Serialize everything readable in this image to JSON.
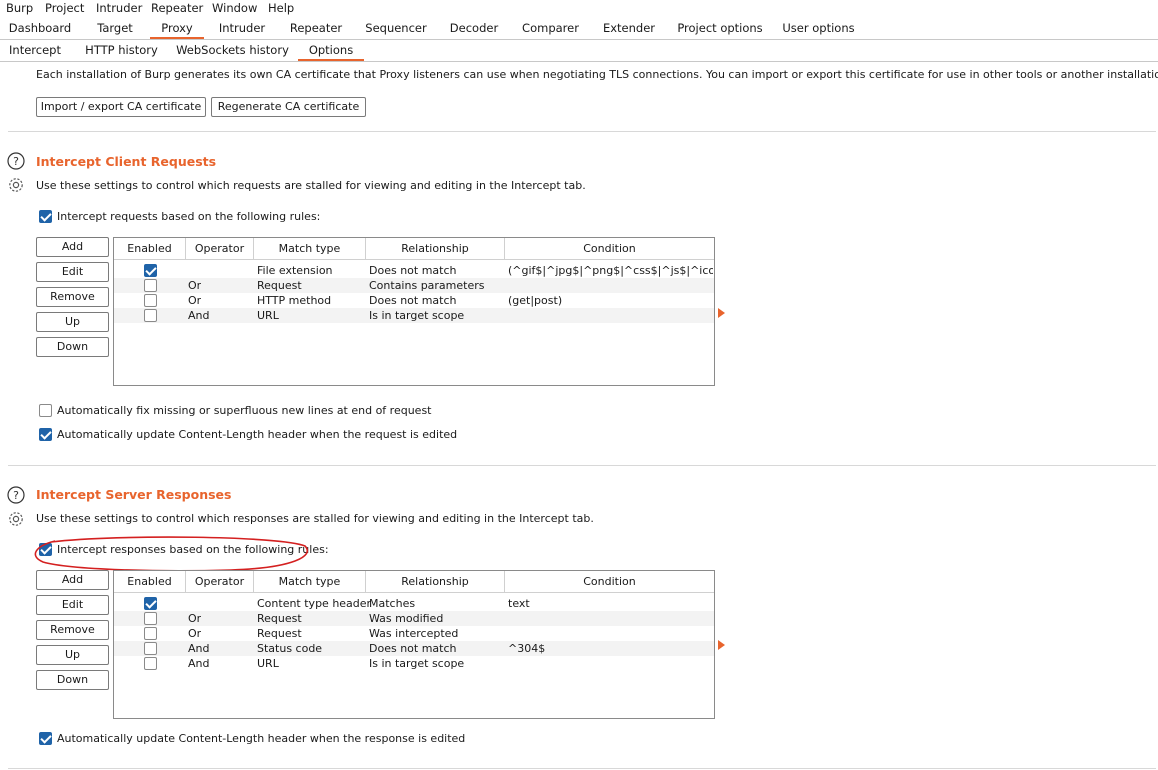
{
  "menu": [
    "Burp",
    "Project",
    "Intruder",
    "Repeater",
    "Window",
    "Help"
  ],
  "main_tabs": [
    "Dashboard",
    "Target",
    "Proxy",
    "Intruder",
    "Repeater",
    "Sequencer",
    "Decoder",
    "Comparer",
    "Extender",
    "Project options",
    "User options"
  ],
  "active_main_tab": "Proxy",
  "sub_tabs": [
    "Intercept",
    "HTTP history",
    "WebSockets history",
    "Options"
  ],
  "active_sub_tab": "Options",
  "ca": {
    "description": "Each installation of Burp generates its own CA certificate that Proxy listeners can use when negotiating TLS connections. You can import or export this certificate for use in other tools or another installation of Burp.",
    "import_export": "Import / export CA certificate",
    "regenerate": "Regenerate CA certificate"
  },
  "client": {
    "title": "Intercept Client Requests",
    "description": "Use these settings to control which requests are stalled for viewing and editing in the Intercept tab.",
    "rules_label": "Intercept requests based on the following rules:",
    "rules_checked": true,
    "buttons": [
      "Add",
      "Edit",
      "Remove",
      "Up",
      "Down"
    ],
    "columns": [
      "Enabled",
      "Operator",
      "Match type",
      "Relationship",
      "Condition"
    ],
    "rows": [
      {
        "enabled": true,
        "operator": "",
        "match_type": "File extension",
        "relationship": "Does not match",
        "condition": "(^gif$|^jpg$|^png$|^css$|^js$|^ico$|..."
      },
      {
        "enabled": false,
        "operator": "Or",
        "match_type": "Request",
        "relationship": "Contains parameters",
        "condition": ""
      },
      {
        "enabled": false,
        "operator": "Or",
        "match_type": "HTTP method",
        "relationship": "Does not match",
        "condition": "(get|post)"
      },
      {
        "enabled": false,
        "operator": "And",
        "match_type": "URL",
        "relationship": "Is in target scope",
        "condition": ""
      }
    ],
    "fix_newlines_label": "Automatically fix missing or superfluous new lines at end of request",
    "fix_newlines_checked": false,
    "update_length_label": "Automatically update Content-Length header when the request is edited",
    "update_length_checked": true
  },
  "server": {
    "title": "Intercept Server Responses",
    "description": "Use these settings to control which responses are stalled for viewing and editing in the Intercept tab.",
    "rules_label": "Intercept responses based on the following rules:",
    "rules_checked": true,
    "buttons": [
      "Add",
      "Edit",
      "Remove",
      "Up",
      "Down"
    ],
    "columns": [
      "Enabled",
      "Operator",
      "Match type",
      "Relationship",
      "Condition"
    ],
    "rows": [
      {
        "enabled": true,
        "operator": "",
        "match_type": "Content type header",
        "relationship": "Matches",
        "condition": "text"
      },
      {
        "enabled": false,
        "operator": "Or",
        "match_type": "Request",
        "relationship": "Was modified",
        "condition": ""
      },
      {
        "enabled": false,
        "operator": "Or",
        "match_type": "Request",
        "relationship": "Was intercepted",
        "condition": ""
      },
      {
        "enabled": false,
        "operator": "And",
        "match_type": "Status code",
        "relationship": "Does not match",
        "condition": "^304$"
      },
      {
        "enabled": false,
        "operator": "And",
        "match_type": "URL",
        "relationship": "Is in target scope",
        "condition": ""
      }
    ],
    "update_length_label": "Automatically update Content-Length header when the response is edited",
    "update_length_checked": true
  },
  "colors": {
    "accent": "#e8642d",
    "checkbox": "#1f63a8",
    "annotation": "#d42020"
  },
  "icons": {
    "help": "help-circle-icon",
    "settings": "gear-icon",
    "row_pointer": "orange-arrow-icon"
  }
}
